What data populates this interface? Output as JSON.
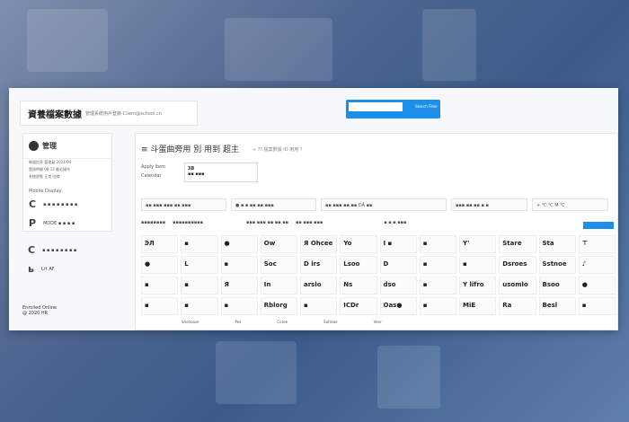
{
  "header": {
    "logo": "資養檔案數據",
    "tagline": "管理系統用戶登錄-Client@school.cn"
  },
  "search": {
    "placeholder": "",
    "button": "Search Filter"
  },
  "sidebar": {
    "name": "管理",
    "lines": [
      "賬號信息 管理員 2021-04",
      "登錄時間 08:12 最近操作",
      "系統狀態 正常 在線"
    ],
    "section": "Mobile Display",
    "rows": [
      {
        "glyph": "C",
        "text": "▪ ▪ ▪ ▪ ▪ ▪ ▪ ▪"
      },
      {
        "glyph": "P",
        "text": "MODE ▪ ▪ ▪ ▪"
      },
      {
        "glyph": "C",
        "text": "▪ ▪ ▪ ▪ ▪ ▪ ▪ ▪"
      },
      {
        "glyph": "ь",
        "text": "Lrt   AF"
      }
    ],
    "footer": [
      "Enrolled Online",
      "@ 2020 HR"
    ]
  },
  "main": {
    "title": "≡ 斗蛋曲旁用 別 用到 超主",
    "subtitle": "≈ ?? 檔案數據 ID 用用 ?",
    "card": {
      "label1": "Apply item",
      "label2": "Calendar",
      "value": "3B",
      "sub": "▪▪ ▪▪▪"
    },
    "chips": [
      "▪▪ ▪▪▪ ▪▪▪ ▪▪ ▪▪▪",
      "● ▪ ▪ ▪▪ ▪▪ ▪▪▪",
      "▪▪ ▪▪▪ ▪▪ ▪▪ ÐÃ ▪▪",
      "▪▪▪ ▪▪ ▪▪ ▪ ▪",
      "+ ℃ ℃ M ℃"
    ],
    "col_headers": [
      "▪▪▪▪▪▪▪▪",
      "▪▪▪▪▪▪▪▪▪▪",
      "▪▪▪ ▪▪▪ ▪▪ ▪▪ ▪▪",
      "▪▪ ▪▪▪ ▪▪▪",
      "▪ ▪ ▪ ▪▪▪"
    ],
    "rows": [
      [
        "ϿЛ",
        "▪",
        "●",
        "Ow",
        "Я Ohcee",
        "Yo",
        "I ▪",
        "▪",
        "Y'",
        "Stare",
        "Sta",
        "⊤"
      ],
      [
        "●",
        "L",
        "▪",
        "Soc",
        "D irs",
        "Lsoo",
        "D",
        "▪",
        "▪",
        "Dsroes",
        "Sstnoe",
        "♪"
      ],
      [
        "▪",
        "▪",
        "Я",
        "In",
        "arslo",
        "Ns",
        "dso",
        "▪",
        "Y lifro",
        "usomlo",
        "Bsoo",
        "●"
      ],
      [
        "▪",
        "▪",
        "▪",
        "Rblorg",
        "▪",
        "ICDr",
        "Oas●",
        "▪",
        "MiE",
        "Ra",
        "Besl",
        "▪"
      ]
    ],
    "footer": [
      "Shohoase",
      "Pes",
      "Coroe",
      "Sutreoe",
      "Veer"
    ]
  }
}
